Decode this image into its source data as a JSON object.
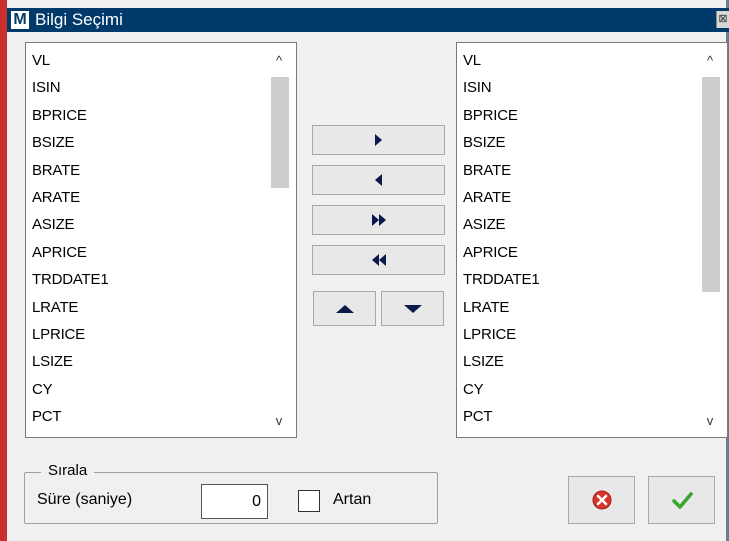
{
  "window": {
    "title": "Bilgi Seçimi",
    "app_icon_letter": "M",
    "close_glyph": "⊠"
  },
  "source_list": {
    "items": [
      "VL",
      "ISIN",
      "BPRICE",
      "BSIZE",
      "BRATE",
      "ARATE",
      "ASIZE",
      "APRICE",
      "TRDDATE1",
      "LRATE",
      "LPRICE",
      "LSIZE",
      "CY",
      "PCT"
    ],
    "scroll_up_glyph": "^",
    "scroll_down_glyph": "v",
    "scroll_thumb_fraction": 0.32
  },
  "target_list": {
    "items": [
      "VL",
      "ISIN",
      "BPRICE",
      "BSIZE",
      "BRATE",
      "ARATE",
      "ASIZE",
      "APRICE",
      "TRDDATE1",
      "LRATE",
      "LPRICE",
      "LSIZE",
      "CY",
      "PCT"
    ],
    "scroll_up_glyph": "^",
    "scroll_down_glyph": "v",
    "scroll_thumb_fraction": 0.62
  },
  "transfer_buttons": {
    "add_icon": "triangle-right-icon",
    "remove_icon": "triangle-left-icon",
    "add_all_icon": "double-triangle-right-icon",
    "remove_all_icon": "double-triangle-left-icon",
    "move_up_icon": "triangle-up-icon",
    "move_down_icon": "triangle-down-icon"
  },
  "sort_group": {
    "legend": "Sırala",
    "duration_label": "Süre (saniye)",
    "duration_value": "0",
    "ascending_label": "Artan",
    "ascending_checked": false
  },
  "actions": {
    "cancel_icon": "red-x-circle-icon",
    "ok_icon": "green-checkmark-icon"
  },
  "colors": {
    "titlebar": "#003a6b",
    "frame": "#c9302c",
    "arrow": "#0b1a4a",
    "cancel_red": "#d9342b",
    "ok_green": "#3aa52e"
  }
}
